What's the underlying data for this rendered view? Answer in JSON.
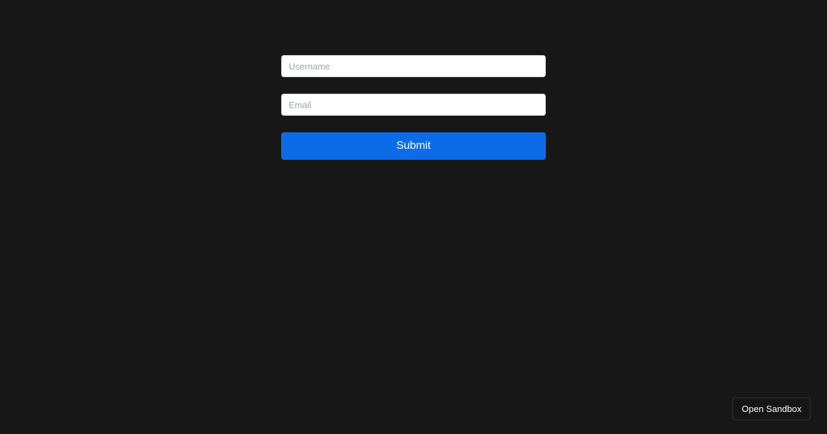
{
  "form": {
    "username": {
      "placeholder": "Username",
      "value": ""
    },
    "email": {
      "placeholder": "Email",
      "value": ""
    },
    "submit_label": "Submit"
  },
  "footer": {
    "open_sandbox_label": "Open Sandbox"
  },
  "colors": {
    "background": "#171717",
    "input_bg": "#ffffff",
    "placeholder": "#9ca3af",
    "button_bg": "#0c6be8",
    "button_text": "#ffffff",
    "sandbox_border": "#333333"
  }
}
